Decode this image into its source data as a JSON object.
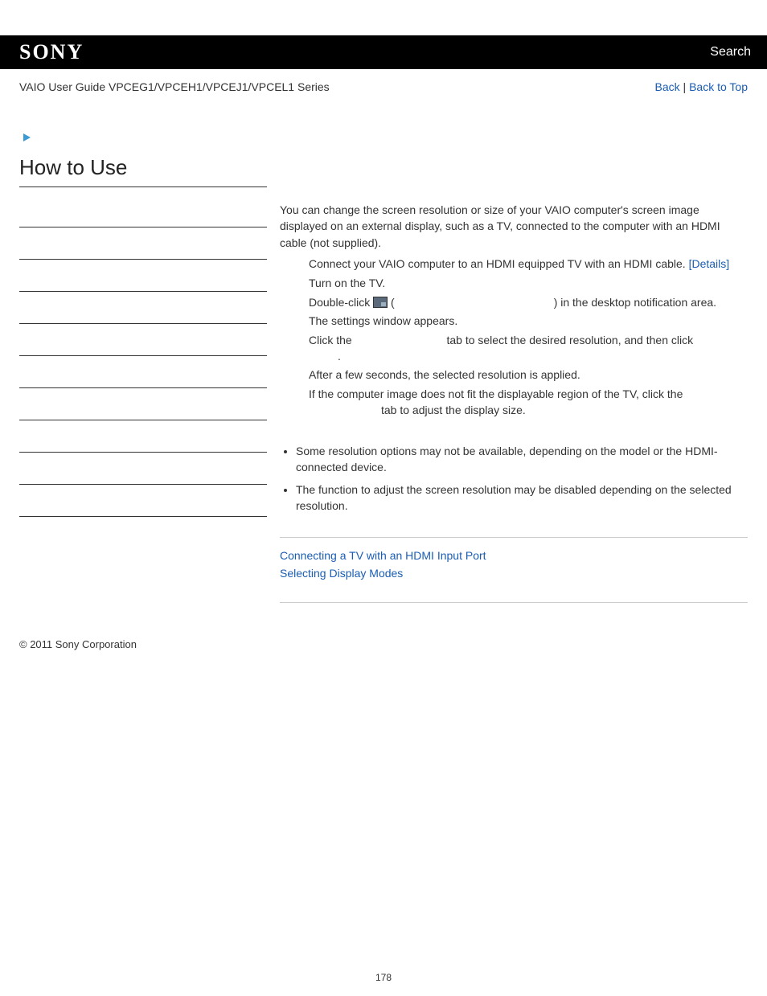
{
  "header": {
    "logo": "SONY",
    "search": "Search"
  },
  "subheader": {
    "guide": "VAIO User Guide VPCEG1/VPCEH1/VPCEJ1/VPCEL1 Series",
    "back": "Back",
    "back_to_top": "Back to Top",
    "separator": " | "
  },
  "left": {
    "title": "How to Use"
  },
  "content": {
    "intro": "You can change the screen resolution or size of your VAIO computer's screen image displayed on an external display, such as a TV, connected to the computer with an HDMI cable (not supplied).",
    "step1_a": "Connect your VAIO computer to an HDMI equipped TV with an HDMI cable. ",
    "step1_link": "[Details]",
    "step2": "Turn on the TV.",
    "step3_a": "Double-click ",
    "step3_b": " (",
    "step3_c": ") in the desktop notification area.",
    "step3_sub": "The settings window appears.",
    "step4_a": "Click the ",
    "step4_b": " tab to select the desired resolution, and then click ",
    "step4_c": ".",
    "step4_sub": "After a few seconds, the selected resolution is applied.",
    "step5_a": "If the computer image does not fit the displayable region of the TV, click the ",
    "step5_b": " tab to adjust the display size.",
    "note1": "Some resolution options may not be available, depending on the model or the HDMI-connected device.",
    "note2": "The function to adjust the screen resolution may be disabled depending on the selected resolution.",
    "related1": "Connecting a TV with an HDMI Input Port",
    "related2": "Selecting Display Modes"
  },
  "footer": {
    "copyright": "© 2011 Sony Corporation",
    "page": "178"
  }
}
